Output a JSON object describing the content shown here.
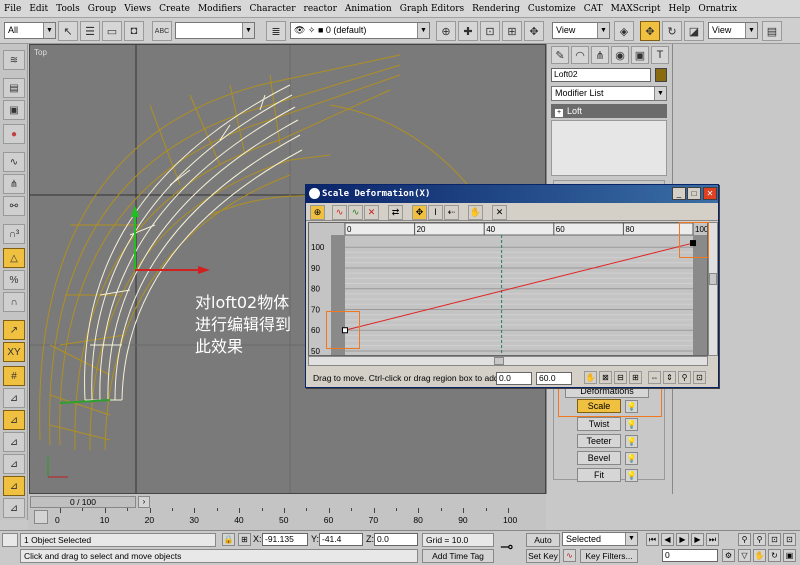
{
  "menu": [
    "File",
    "Edit",
    "Tools",
    "Group",
    "Views",
    "Create",
    "Modifiers",
    "Character",
    "reactor",
    "Animation",
    "Graph Editors",
    "Rendering",
    "Customize",
    "CAT",
    "MAXScript",
    "Help",
    "Ornatrix"
  ],
  "toolbar": {
    "filter": "All",
    "layer": "0 (default)",
    "view1": "View",
    "view2": "View"
  },
  "viewport": {
    "label": "Top",
    "annotation": "对loft02物体\n进行编辑得到\n此效果"
  },
  "command_panel": {
    "object_name": "Loft02",
    "modifier_list": "Modifier List",
    "stack_item": "Loft",
    "rollout_title": "Deformations",
    "deform_buttons": [
      "Scale",
      "Twist",
      "Teeter",
      "Bevel",
      "Fit"
    ],
    "accent": "#f0c040"
  },
  "dialog": {
    "title": "Scale Deformation(X)",
    "ruler_ticks": [
      "0",
      "20",
      "40",
      "60",
      "80",
      "100"
    ],
    "y_labels": [
      "100",
      "90",
      "80",
      "70",
      "60",
      "50"
    ],
    "status_text": "Drag to move. Ctrl-click or drag region box to add to sel",
    "field1": "0.0",
    "field2": "60.0"
  },
  "chart_data": {
    "type": "line",
    "x": [
      0,
      100
    ],
    "y": [
      60,
      102
    ],
    "xlim": [
      0,
      100
    ],
    "ylim": [
      50,
      103
    ]
  },
  "timeline": {
    "slider_label": "0 / 100",
    "ticks": [
      "0",
      "10",
      "20",
      "30",
      "40",
      "50",
      "60",
      "70",
      "80",
      "90",
      "100"
    ]
  },
  "status": {
    "selection": "1 Object Selected",
    "prompt": "Click and drag to select and move objects",
    "x_label": "X:",
    "x_value": "-91.135",
    "y_label": "Y:",
    "y_value": "-41.4",
    "z_label": "Z:",
    "z_value": "0.0",
    "grid": "Grid = 10.0",
    "add_time_tag": "Add Time Tag",
    "auto_key": "Auto Key",
    "selected": "Selected",
    "set_key": "Set Key",
    "key_filters": "Key Filters...",
    "frame": "0"
  }
}
